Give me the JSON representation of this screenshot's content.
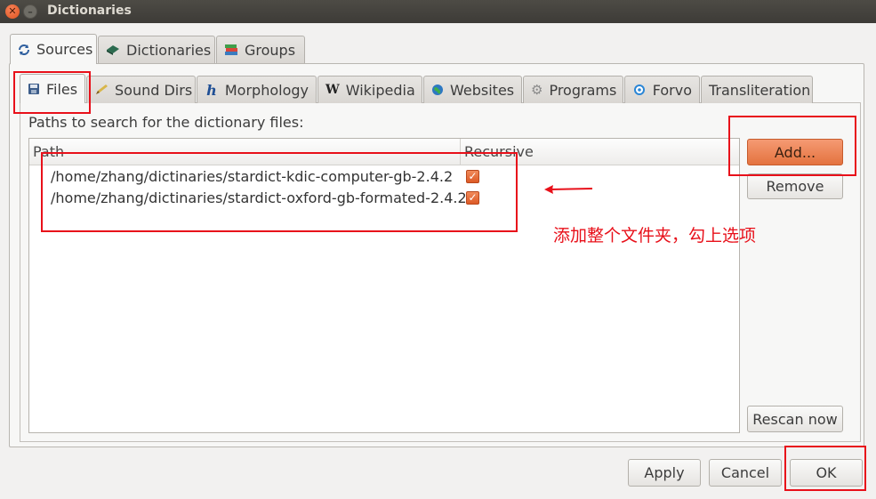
{
  "window": {
    "title": "Dictionaries"
  },
  "top_tabs": [
    {
      "label": "Sources",
      "icon": "refresh-icon"
    },
    {
      "label": "Dictionaries",
      "icon": "book-icon"
    },
    {
      "label": "Groups",
      "icon": "books-stack-icon"
    }
  ],
  "source_tabs": [
    {
      "label": "Files",
      "icon": "disk-icon"
    },
    {
      "label": "Sound Dirs",
      "icon": "pencil-icon"
    },
    {
      "label": "Morphology",
      "icon": "h-letter-icon"
    },
    {
      "label": "Wikipedia",
      "icon": "wikipedia-w-icon"
    },
    {
      "label": "Websites",
      "icon": "globe-icon"
    },
    {
      "label": "Programs",
      "icon": "gear-icon"
    },
    {
      "label": "Forvo",
      "icon": "forvo-icon"
    },
    {
      "label": "Transliteration",
      "icon": ""
    }
  ],
  "files": {
    "paths_label": "Paths to search for the dictionary files:",
    "columns": [
      "Path",
      "Recursive"
    ],
    "rows": [
      {
        "path": "/home/zhang/dictinaries/stardict-kdic-computer-gb-2.4.2",
        "recursive": true
      },
      {
        "path": "/home/zhang/dictinaries/stardict-oxford-gb-formated-2.4.2",
        "recursive": true
      }
    ],
    "add_label": "Add...",
    "remove_label": "Remove",
    "rescan_label": "Rescan now"
  },
  "footer": {
    "apply_label": "Apply",
    "cancel_label": "Cancel",
    "ok_label": "OK"
  },
  "annotation": {
    "text": "添加整个文件夹，勾上选项",
    "color": "#e8101a"
  },
  "colors": {
    "accent": "#e4733f",
    "checkbox": "#dd5a26"
  }
}
